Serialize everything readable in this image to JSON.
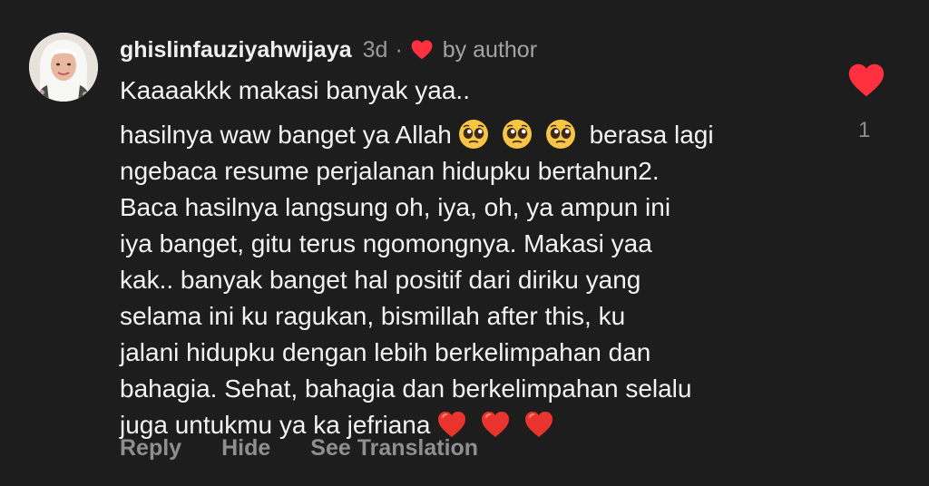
{
  "comment": {
    "author": "ghislinfauziyahwijaya",
    "time": "3d",
    "separator": "·",
    "badge": "by author",
    "greeting": "Kaaaakkk makasi banyak yaa..",
    "line1_text": "hasilnya waw banget ya Allah",
    "line1_after": "berasa lagi",
    "lines": [
      "ngebaca resume perjalanan hidupku bertahun2.",
      "Baca hasilnya langsung oh, iya, oh, ya ampun ini",
      "iya banget, gitu terus ngomongnya. Makasi yaa",
      "kak.. banyak banget hal positif dari diriku yang",
      "selama ini ku ragukan, bismillah after this, ku",
      "jalani hidupku dengan lebih berkelimpahan dan",
      "bahagia. Sehat, bahagia dan berkelimpahan selalu"
    ],
    "last_line": "juga untukmu ya ka jefriana",
    "emojis": [
      "pleading-face-emoji",
      "red-heart-emoji"
    ]
  },
  "actions": {
    "reply": "Reply",
    "hide": "Hide",
    "translate": "See Translation"
  },
  "likes": {
    "count": "1",
    "liked": true,
    "color": "#ff3040"
  },
  "colors": {
    "background": "#1d1d1d",
    "text": "#f3f3f3",
    "muted": "#9a9a9a"
  }
}
